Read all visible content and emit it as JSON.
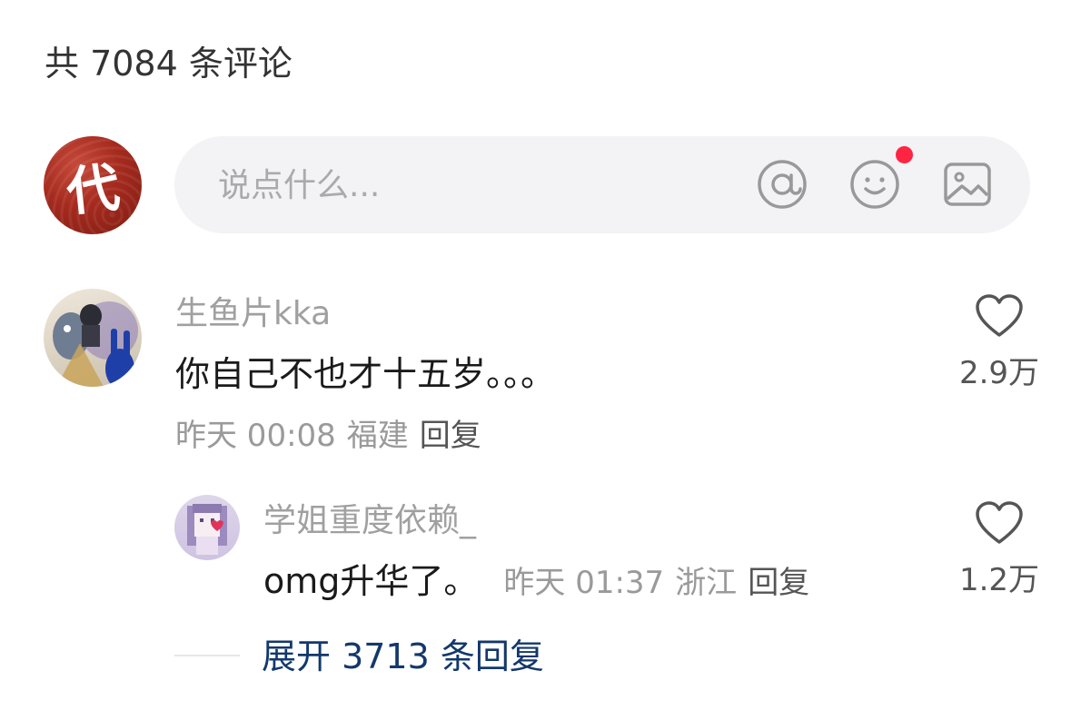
{
  "header": {
    "comment_count_text": "共 7084 条评论"
  },
  "composer": {
    "avatar_char": "代",
    "placeholder": "说点什么...",
    "icons": [
      "at-icon",
      "emoji-icon",
      "image-icon"
    ],
    "notification_dot_color": "#ff2442"
  },
  "comments": [
    {
      "username": "生鱼片kka",
      "content": "你自己不也才十五岁。。。",
      "time": "昨天 00:08",
      "location": "福建",
      "reply_label": "回复",
      "likes": "2.9万",
      "replies": [
        {
          "username": "学姐重度依赖_",
          "content": "omg升华了。",
          "time": "昨天 01:37",
          "location": "浙江",
          "reply_label": "回复",
          "likes": "1.2万"
        }
      ],
      "expand_text": "展开 3713 条回复"
    }
  ],
  "colors": {
    "link": "#13386c",
    "muted": "#a0a0a0",
    "input_bg": "#f3f3f5"
  }
}
